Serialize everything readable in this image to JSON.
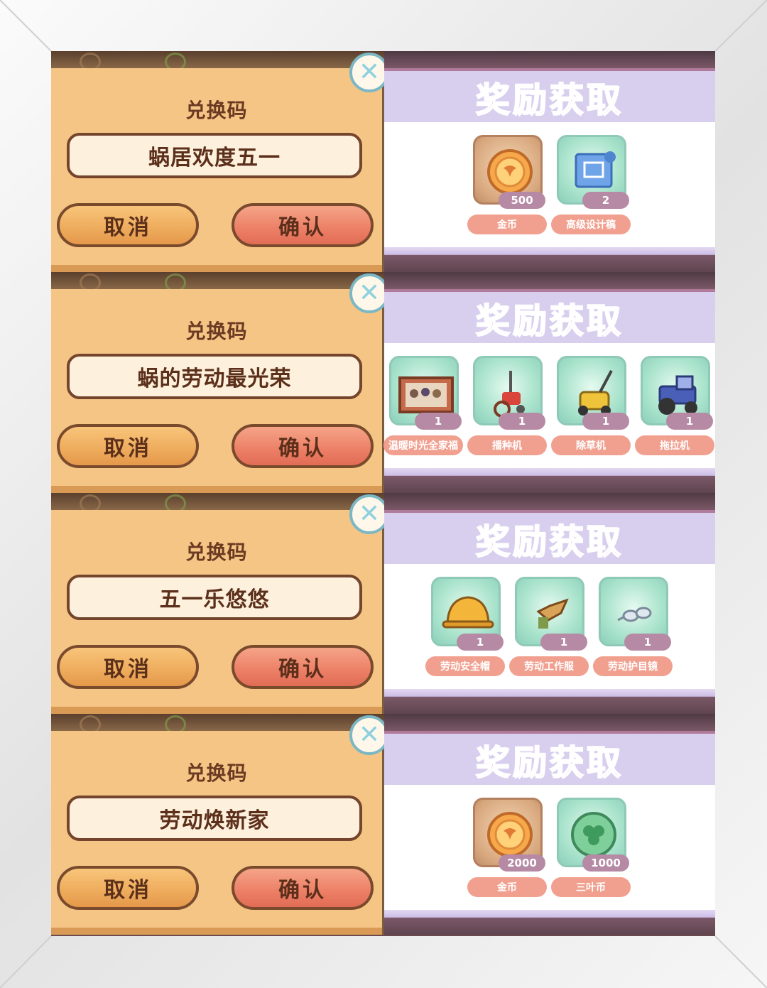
{
  "rows": [
    {
      "dialog": {
        "title": "兑换码",
        "code": "蜗居欢度五一",
        "cancel_label": "取消",
        "confirm_label": "确认",
        "close_glyph": "✕"
      },
      "reward": {
        "heading": "奖励获取",
        "items": [
          {
            "name": "金币",
            "count": "500",
            "icon": "gold-coin-icon"
          },
          {
            "name": "高级设计稿",
            "count": "2",
            "icon": "blueprint-icon"
          }
        ]
      }
    },
    {
      "dialog": {
        "title": "兑换码",
        "code": "蜗的劳动最光荣",
        "cancel_label": "取消",
        "confirm_label": "确认",
        "close_glyph": "✕"
      },
      "reward": {
        "heading": "奖励获取",
        "items": [
          {
            "name": "温暖时光全家福",
            "count": "1",
            "icon": "family-photo-icon"
          },
          {
            "name": "播种机",
            "count": "1",
            "icon": "seeder-icon"
          },
          {
            "name": "除草机",
            "count": "1",
            "icon": "lawn-mower-icon"
          },
          {
            "name": "拖拉机",
            "count": "1",
            "icon": "tractor-icon"
          }
        ]
      }
    },
    {
      "dialog": {
        "title": "兑换码",
        "code": "五一乐悠悠",
        "cancel_label": "取消",
        "confirm_label": "确认",
        "close_glyph": "✕"
      },
      "reward": {
        "heading": "奖励获取",
        "items": [
          {
            "name": "劳动安全帽",
            "count": "1",
            "icon": "safety-helmet-icon"
          },
          {
            "name": "劳动工作服",
            "count": "1",
            "icon": "work-clothes-icon"
          },
          {
            "name": "劳动护目镜",
            "count": "1",
            "icon": "goggles-icon"
          }
        ]
      }
    },
    {
      "dialog": {
        "title": "兑换码",
        "code": "劳动焕新家",
        "cancel_label": "取消",
        "confirm_label": "确认",
        "close_glyph": "✕"
      },
      "reward": {
        "heading": "奖励获取",
        "items": [
          {
            "name": "金币",
            "count": "2000",
            "icon": "gold-coin-icon"
          },
          {
            "name": "三叶币",
            "count": "1000",
            "icon": "clover-coin-icon"
          }
        ]
      }
    }
  ],
  "colors": {
    "dialog_bg": "#f5c585",
    "confirm_button": "#ec7f66",
    "cancel_button": "#eeab5c",
    "reward_heading": "#e0609a",
    "reward_header_bg": "#d8cfee",
    "item_name_pill": "#f1a08f",
    "item_count_pill": "#b68aa4"
  }
}
